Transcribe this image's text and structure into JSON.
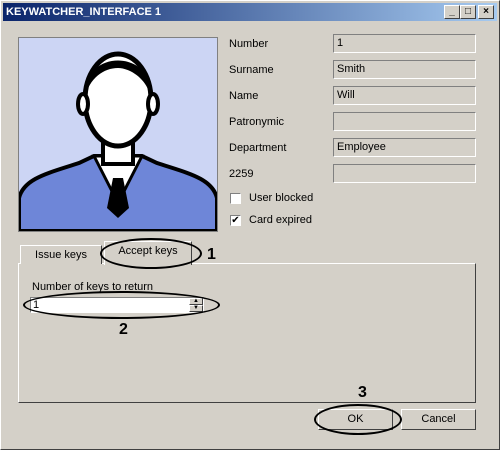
{
  "window": {
    "title": "KEYWATCHER_INTERFACE 1"
  },
  "title_buttons": {
    "minimize": "_",
    "maximize": "□",
    "close": "×"
  },
  "photo": {
    "description_icon": "person-silhouette-icon"
  },
  "fields": {
    "number": {
      "label": "Number",
      "value": "1"
    },
    "surname": {
      "label": "Surname",
      "value": "Smith"
    },
    "name": {
      "label": "Name",
      "value": "Will"
    },
    "patronymic": {
      "label": "Patronymic",
      "value": ""
    },
    "department": {
      "label": "Department",
      "value": "Employee"
    },
    "code": {
      "label": "2259",
      "value": ""
    }
  },
  "checkboxes": {
    "user_blocked": {
      "label": "User blocked",
      "checked": false,
      "mark": ""
    },
    "card_expired": {
      "label": "Card expired",
      "checked": true,
      "mark": "✔"
    }
  },
  "tabs": {
    "issue": "Issue keys",
    "accept": "Accept keys",
    "active": "accept"
  },
  "panel": {
    "keys_label": "Number of keys to return",
    "keys_value": "1"
  },
  "spinner": {
    "up": "▲",
    "down": "▼"
  },
  "buttons": {
    "ok": "OK",
    "cancel": "Cancel"
  },
  "annotations": {
    "one": "1",
    "two": "2",
    "three": "3"
  }
}
